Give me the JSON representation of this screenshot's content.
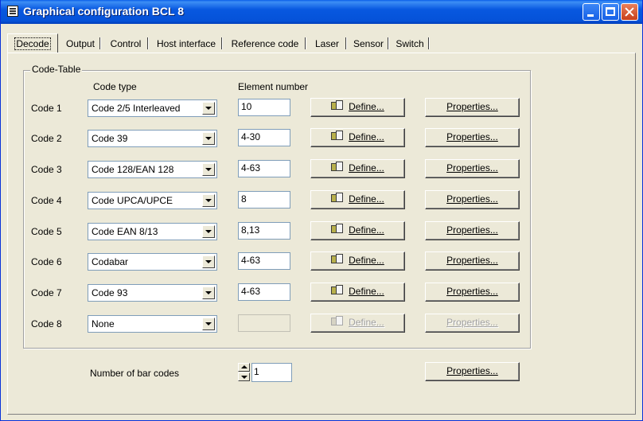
{
  "window": {
    "title": "Graphical configuration BCL 8"
  },
  "tabs": [
    {
      "label": "Decode",
      "active": true
    },
    {
      "label": "Output"
    },
    {
      "label": "Control"
    },
    {
      "label": "Host interface"
    },
    {
      "label": "Reference code"
    },
    {
      "label": "Laser"
    },
    {
      "label": "Sensor"
    },
    {
      "label": "Switch"
    }
  ],
  "code_table": {
    "legend": "Code-Table",
    "col_code_type": "Code type",
    "col_element_number": "Element number",
    "define_label": "Define...",
    "properties_label": "Properties...",
    "rows": [
      {
        "label": "Code 1",
        "type": "Code 2/5 Interleaved",
        "element": "10",
        "enabled": true
      },
      {
        "label": "Code 2",
        "type": "Code 39",
        "element": "4-30",
        "enabled": true
      },
      {
        "label": "Code 3",
        "type": "Code 128/EAN 128",
        "element": "4-63",
        "enabled": true
      },
      {
        "label": "Code 4",
        "type": "Code UPCA/UPCE",
        "element": "8",
        "enabled": true
      },
      {
        "label": "Code 5",
        "type": "Code EAN 8/13",
        "element": "8,13",
        "enabled": true
      },
      {
        "label": "Code 6",
        "type": "Codabar",
        "element": "4-63",
        "enabled": true
      },
      {
        "label": "Code 7",
        "type": "Code 93",
        "element": "4-63",
        "enabled": true
      },
      {
        "label": "Code 8",
        "type": "None",
        "element": "",
        "enabled": false
      }
    ]
  },
  "bar_codes": {
    "label": "Number of bar codes",
    "value": "1",
    "properties_label": "Properties..."
  }
}
